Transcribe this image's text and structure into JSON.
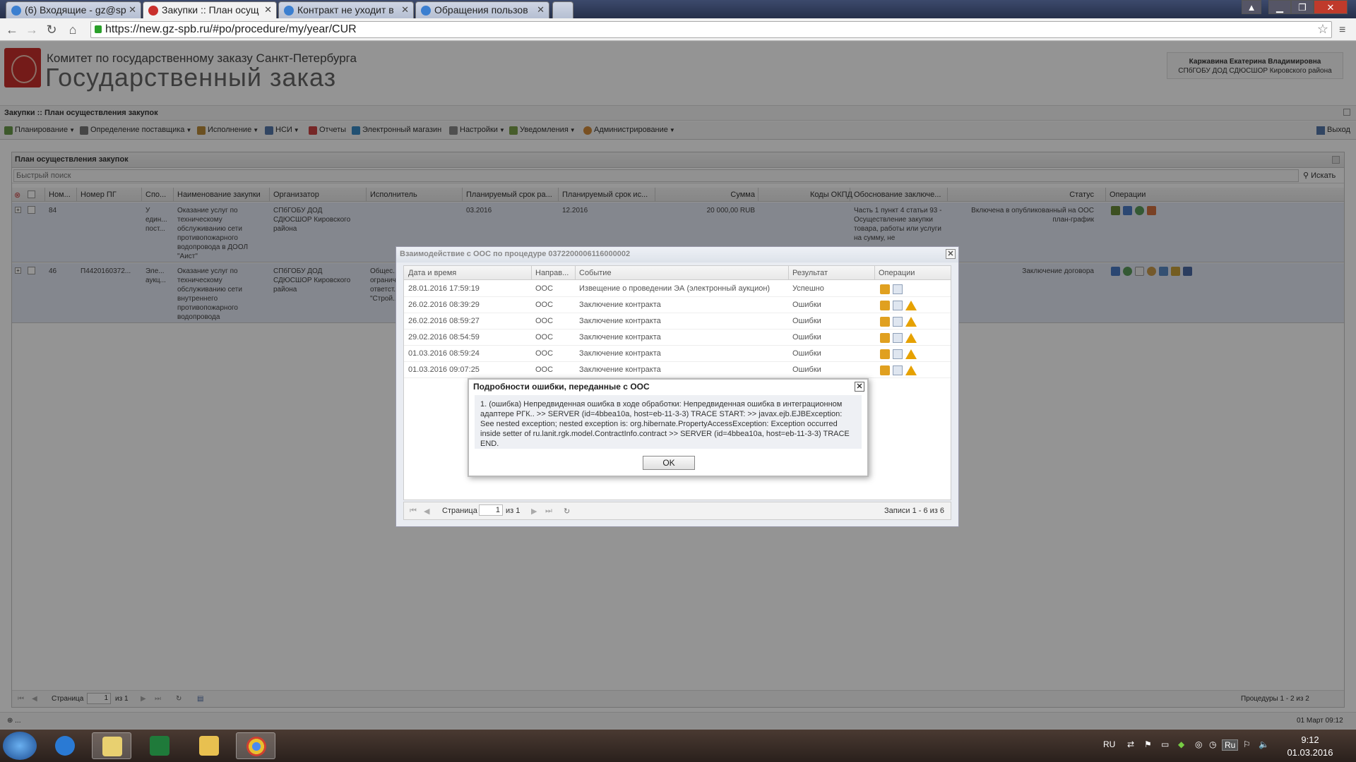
{
  "browser": {
    "tabs": [
      {
        "title": "(6) Входящие - gz@sp"
      },
      {
        "title": "Закупки :: План осущ"
      },
      {
        "title": "Контракт не уходит в"
      },
      {
        "title": "Обращения пользов"
      }
    ],
    "url": "https://new.gz-spb.ru/#po/procedure/my/year/CUR"
  },
  "header": {
    "org_line": "Комитет по государственному заказу Санкт-Петербурга",
    "site_title": "Государственный заказ",
    "user_name": "Каржавина Екатерина Владимировна",
    "user_org": "СПбГОБУ ДОД СДЮСШОР Кировского района"
  },
  "breadcrumb": "Закупки :: План осуществления закупок",
  "menu": [
    {
      "label": "Планирование",
      "icon": "planning-icon",
      "dropdown": true
    },
    {
      "label": "Определение поставщика",
      "icon": "supplier-icon",
      "dropdown": true
    },
    {
      "label": "Исполнение",
      "icon": "execution-icon",
      "dropdown": true
    },
    {
      "label": "НСИ",
      "icon": "nsi-icon",
      "dropdown": true
    },
    {
      "label": "Отчеты",
      "icon": "reports-icon",
      "dropdown": false
    },
    {
      "label": "Электронный магазин",
      "icon": "shop-icon",
      "dropdown": false
    },
    {
      "label": "Настройки",
      "icon": "settings-icon",
      "dropdown": true
    },
    {
      "label": "Уведомления",
      "icon": "notifications-icon",
      "dropdown": true
    },
    {
      "label": "Администрирование",
      "icon": "admin-icon",
      "dropdown": true
    }
  ],
  "exit_label": "Выход",
  "panel": {
    "title": "План осуществления закупок",
    "search_placeholder": "Быстрый поиск",
    "search_button": "Искать",
    "columns": [
      "Ном...",
      "Номер ПГ",
      "Спо...",
      "Наименование закупки",
      "Организатор",
      "Исполнитель",
      "Планируемый срок ра...",
      "Планируемый срок ис...",
      "Сумма",
      "Коды ОКПД",
      "Обоснование заключе...",
      "Статус",
      "Операции"
    ],
    "rows": [
      {
        "num": "84",
        "pg": "",
        "method": "У един... пост...",
        "name": "Оказание услуг по техническому обслуживанию сети противопожарного водопровода в ДООЛ \"Аист\"",
        "organizer": "СПбГОБУ ДОД СДЮСШОР Кировского района",
        "executor": "",
        "plan_start": "03.2016",
        "plan_end": "12.2016",
        "sum": "20 000,00 RUB",
        "okpd": "",
        "basis": "Часть 1 пункт 4 статьи 93 - Осуществление закупки товара, работы или услуги на сумму, не",
        "status": "Включена в опубликованный на ООС план-график"
      },
      {
        "num": "46",
        "pg": "П4420160372...",
        "method": "Эле... аукц...",
        "name": "Оказание услуг по техническому обслуживанию сети внутреннего противопожарного водопровода",
        "organizer": "СПбГОБУ ДОД СДЮСШОР Кировского района",
        "executor": "Общес... огранич... ответст... \"Строй...",
        "plan_start": "",
        "plan_end": "",
        "sum": "",
        "okpd": "",
        "basis": "",
        "status": "Заключение договора"
      }
    ],
    "pager": {
      "page_label": "Страница",
      "page": "1",
      "of": "из 1",
      "summary": "Процедуры 1 - 2 из 2"
    }
  },
  "status_left": "⊕ ...",
  "status_right": "01 Март 09:12",
  "dialog_oos": {
    "title": "Взаимодействие с ООС по процедуре 0372200006116000002",
    "columns": [
      "Дата и время",
      "Направ...",
      "Событие",
      "Результат",
      "Операции"
    ],
    "rows": [
      {
        "datetime": "28.01.2016 17:59:19",
        "dir": "ООС",
        "event": "Извещение о проведении ЭА (электронный аукцион)",
        "result": "Успешно"
      },
      {
        "datetime": "26.02.2016 08:39:29",
        "dir": "ООС",
        "event": "Заключение контракта",
        "result": "Ошибки"
      },
      {
        "datetime": "26.02.2016 08:59:27",
        "dir": "ООС",
        "event": "Заключение контракта",
        "result": "Ошибки"
      },
      {
        "datetime": "29.02.2016 08:54:59",
        "dir": "ООС",
        "event": "Заключение контракта",
        "result": "Ошибки"
      },
      {
        "datetime": "01.03.2016 08:59:24",
        "dir": "ООС",
        "event": "Заключение контракта",
        "result": "Ошибки"
      },
      {
        "datetime": "01.03.2016 09:07:25",
        "dir": "ООС",
        "event": "Заключение контракта",
        "result": "Ошибки"
      }
    ],
    "pager": {
      "page_label": "Страница",
      "page": "1",
      "of": "из 1",
      "summary": "Записи 1 - 6 из 6"
    }
  },
  "dialog_error": {
    "title": "Подробности ошибки, переданные с ООС",
    "message": "1. (ошибка) Непредвиденная ошибка в ходе обработки: Непредвиденная ошибка в интеграционном адаптере РГК.. >> SERVER (id=4bbea10a, host=eb-11-3-3) TRACE START: >> javax.ejb.EJBException: See nested exception; nested exception is: org.hibernate.PropertyAccessException: Exception occurred inside setter of ru.lanit.rgk.model.ContractInfo.contract >> SERVER (id=4bbea10a, host=eb-11-3-3) TRACE END.",
    "ok": "OK"
  },
  "taskbar": {
    "lang": "RU",
    "tray_lang": "Ru",
    "time": "9:12",
    "date": "01.03.2016"
  }
}
